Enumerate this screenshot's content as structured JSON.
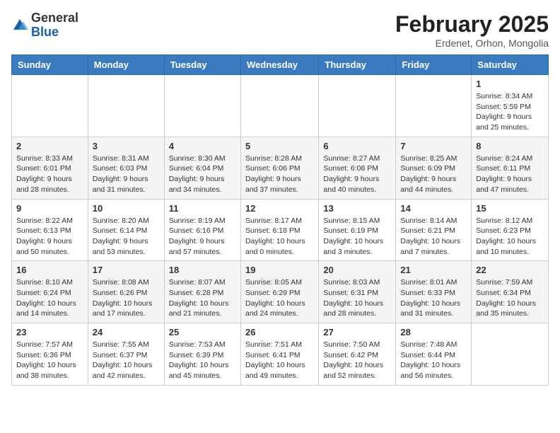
{
  "header": {
    "logo_general": "General",
    "logo_blue": "Blue",
    "month_title": "February 2025",
    "location": "Erdenet, Orhon, Mongolia"
  },
  "weekdays": [
    "Sunday",
    "Monday",
    "Tuesday",
    "Wednesday",
    "Thursday",
    "Friday",
    "Saturday"
  ],
  "weeks": [
    [
      {
        "day": "",
        "info": ""
      },
      {
        "day": "",
        "info": ""
      },
      {
        "day": "",
        "info": ""
      },
      {
        "day": "",
        "info": ""
      },
      {
        "day": "",
        "info": ""
      },
      {
        "day": "",
        "info": ""
      },
      {
        "day": "1",
        "info": "Sunrise: 8:34 AM\nSunset: 5:59 PM\nDaylight: 9 hours\nand 25 minutes."
      }
    ],
    [
      {
        "day": "2",
        "info": "Sunrise: 8:33 AM\nSunset: 6:01 PM\nDaylight: 9 hours\nand 28 minutes."
      },
      {
        "day": "3",
        "info": "Sunrise: 8:31 AM\nSunset: 6:03 PM\nDaylight: 9 hours\nand 31 minutes."
      },
      {
        "day": "4",
        "info": "Sunrise: 8:30 AM\nSunset: 6:04 PM\nDaylight: 9 hours\nand 34 minutes."
      },
      {
        "day": "5",
        "info": "Sunrise: 8:28 AM\nSunset: 6:06 PM\nDaylight: 9 hours\nand 37 minutes."
      },
      {
        "day": "6",
        "info": "Sunrise: 8:27 AM\nSunset: 6:08 PM\nDaylight: 9 hours\nand 40 minutes."
      },
      {
        "day": "7",
        "info": "Sunrise: 8:25 AM\nSunset: 6:09 PM\nDaylight: 9 hours\nand 44 minutes."
      },
      {
        "day": "8",
        "info": "Sunrise: 8:24 AM\nSunset: 6:11 PM\nDaylight: 9 hours\nand 47 minutes."
      }
    ],
    [
      {
        "day": "9",
        "info": "Sunrise: 8:22 AM\nSunset: 6:13 PM\nDaylight: 9 hours\nand 50 minutes."
      },
      {
        "day": "10",
        "info": "Sunrise: 8:20 AM\nSunset: 6:14 PM\nDaylight: 9 hours\nand 53 minutes."
      },
      {
        "day": "11",
        "info": "Sunrise: 8:19 AM\nSunset: 6:16 PM\nDaylight: 9 hours\nand 57 minutes."
      },
      {
        "day": "12",
        "info": "Sunrise: 8:17 AM\nSunset: 6:18 PM\nDaylight: 10 hours\nand 0 minutes."
      },
      {
        "day": "13",
        "info": "Sunrise: 8:15 AM\nSunset: 6:19 PM\nDaylight: 10 hours\nand 3 minutes."
      },
      {
        "day": "14",
        "info": "Sunrise: 8:14 AM\nSunset: 6:21 PM\nDaylight: 10 hours\nand 7 minutes."
      },
      {
        "day": "15",
        "info": "Sunrise: 8:12 AM\nSunset: 6:23 PM\nDaylight: 10 hours\nand 10 minutes."
      }
    ],
    [
      {
        "day": "16",
        "info": "Sunrise: 8:10 AM\nSunset: 6:24 PM\nDaylight: 10 hours\nand 14 minutes."
      },
      {
        "day": "17",
        "info": "Sunrise: 8:08 AM\nSunset: 6:26 PM\nDaylight: 10 hours\nand 17 minutes."
      },
      {
        "day": "18",
        "info": "Sunrise: 8:07 AM\nSunset: 6:28 PM\nDaylight: 10 hours\nand 21 minutes."
      },
      {
        "day": "19",
        "info": "Sunrise: 8:05 AM\nSunset: 6:29 PM\nDaylight: 10 hours\nand 24 minutes."
      },
      {
        "day": "20",
        "info": "Sunrise: 8:03 AM\nSunset: 6:31 PM\nDaylight: 10 hours\nand 28 minutes."
      },
      {
        "day": "21",
        "info": "Sunrise: 8:01 AM\nSunset: 6:33 PM\nDaylight: 10 hours\nand 31 minutes."
      },
      {
        "day": "22",
        "info": "Sunrise: 7:59 AM\nSunset: 6:34 PM\nDaylight: 10 hours\nand 35 minutes."
      }
    ],
    [
      {
        "day": "23",
        "info": "Sunrise: 7:57 AM\nSunset: 6:36 PM\nDaylight: 10 hours\nand 38 minutes."
      },
      {
        "day": "24",
        "info": "Sunrise: 7:55 AM\nSunset: 6:37 PM\nDaylight: 10 hours\nand 42 minutes."
      },
      {
        "day": "25",
        "info": "Sunrise: 7:53 AM\nSunset: 6:39 PM\nDaylight: 10 hours\nand 45 minutes."
      },
      {
        "day": "26",
        "info": "Sunrise: 7:51 AM\nSunset: 6:41 PM\nDaylight: 10 hours\nand 49 minutes."
      },
      {
        "day": "27",
        "info": "Sunrise: 7:50 AM\nSunset: 6:42 PM\nDaylight: 10 hours\nand 52 minutes."
      },
      {
        "day": "28",
        "info": "Sunrise: 7:48 AM\nSunset: 6:44 PM\nDaylight: 10 hours\nand 56 minutes."
      },
      {
        "day": "",
        "info": ""
      }
    ]
  ]
}
